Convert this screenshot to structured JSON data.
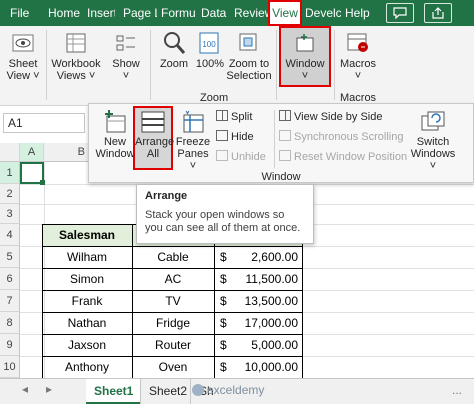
{
  "tabs": [
    {
      "label": "File"
    },
    {
      "label": "Home"
    },
    {
      "label": "Insert"
    },
    {
      "label": "Page L"
    },
    {
      "label": "Formu"
    },
    {
      "label": "Data"
    },
    {
      "label": "Review"
    },
    {
      "label": "View"
    },
    {
      "label": "Develc"
    },
    {
      "label": "Help"
    }
  ],
  "ribbon": {
    "sheet_view": "Sheet\nView ˅",
    "workbook_views": "Workbook\nViews ˅",
    "show": "Show\n˅",
    "zoom": "Zoom",
    "zoom_100": "100%",
    "zoom_to_selection": "Zoom to\nSelection",
    "window": "Window\n˅",
    "macros": "Macros\n˅",
    "group_zoom": "Zoom",
    "group_macros": "Macros",
    "icon_100": "100"
  },
  "formula_bar": {
    "name_box": "A1"
  },
  "window_menu": {
    "new_window": "New\nWindow",
    "arrange_all": "Arrange\nAll",
    "freeze_panes": "Freeze\nPanes ˅",
    "split": "Split",
    "hide": "Hide",
    "unhide": "Unhide",
    "view_side_by_side": "View Side by Side",
    "synchronous_scrolling": "Synchronous Scrolling",
    "reset_window_position": "Reset Window Position",
    "switch_windows": "Switch\nWindows ˅",
    "group_label": "Window"
  },
  "tooltip": {
    "title": "Arrange",
    "body": "Stack your open windows so you can see all of them at once."
  },
  "columns": [
    "A",
    "B"
  ],
  "rows": [
    "1",
    "2",
    "3",
    "4",
    "5",
    "6",
    "7",
    "8",
    "9",
    "10"
  ],
  "table": {
    "header": "Salesman",
    "records": [
      {
        "name": "Wilham",
        "product": "Cable",
        "currency": "$",
        "amount": "2,600.00"
      },
      {
        "name": "Simon",
        "product": "AC",
        "currency": "$",
        "amount": "11,500.00"
      },
      {
        "name": "Frank",
        "product": "TV",
        "currency": "$",
        "amount": "13,500.00"
      },
      {
        "name": "Nathan",
        "product": "Fridge",
        "currency": "$",
        "amount": "17,000.00"
      },
      {
        "name": "Jaxson",
        "product": "Router",
        "currency": "$",
        "amount": "5,000.00"
      },
      {
        "name": "Anthony",
        "product": "Oven",
        "currency": "$",
        "amount": "10,000.00"
      }
    ]
  },
  "sheets": [
    {
      "label": "Sheet1"
    },
    {
      "label": "Sheet2"
    },
    {
      "label": "Sh"
    }
  ],
  "watermark": "exceldemy",
  "nav": {
    "prev": "◂",
    "next": "▸",
    "more": "..."
  },
  "colors": {
    "accent": "#217346",
    "highlight": "#e00000",
    "header_fill": "#e2efda"
  }
}
